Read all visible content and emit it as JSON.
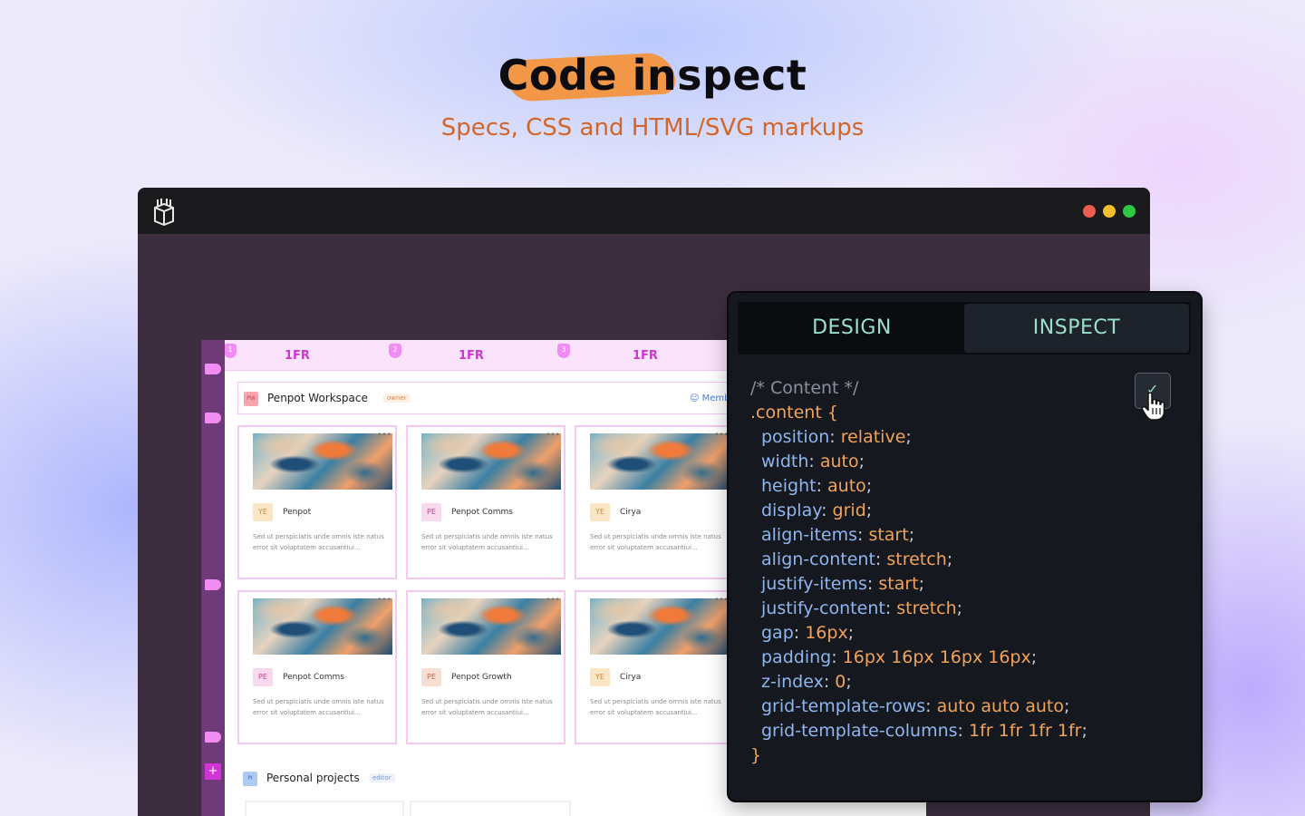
{
  "hero": {
    "title": "Code inspect",
    "subtitle": "Specs, CSS and HTML/SVG markups"
  },
  "colors": {
    "accent_orange": "#f29748",
    "subtitle_orange": "#d1662a",
    "window_bg": "#3c2e3f",
    "panel_bg": "#15181e",
    "tab_text": "#9be0c9",
    "guide_pink": "#d233d6"
  },
  "window": {
    "logo_icon": "penpot-cube-icon",
    "controls": [
      "close",
      "minimize",
      "maximize"
    ]
  },
  "board": {
    "columns": [
      "1FR",
      "1FR",
      "1FR"
    ],
    "column_pins": [
      "1",
      "2",
      "3"
    ],
    "workspace": {
      "avatar": "PW",
      "name": "Penpot Workspace",
      "role": "owner",
      "members_label": "Memb"
    },
    "cards": [
      {
        "avatar": "YE",
        "avatar_bg": "#fbe6c6",
        "avatar_fg": "#c98a2e",
        "title": "Penpot",
        "desc": "Sed ut perspiciatis unde omnis iste natus error sit voluptatem accusantiui..."
      },
      {
        "avatar": "PE",
        "avatar_bg": "#f8d9ee",
        "avatar_fg": "#b8488a",
        "title": "Penpot Comms",
        "desc": "Sed ut perspiciatis unde omnis iste natus error sit voluptatem accusantiui..."
      },
      {
        "avatar": "YE",
        "avatar_bg": "#fbe6c6",
        "avatar_fg": "#c98a2e",
        "title": "Cirya",
        "desc": "Sed ut perspiciatis unde omnis iste natus error sit voluptatem accusantiui..."
      },
      {
        "avatar": "PE",
        "avatar_bg": "#f8d9ee",
        "avatar_fg": "#b8488a",
        "title": "Penpot Comms",
        "desc": "Sed ut perspiciatis unde omnis iste natus error sit voluptatem accusantiui..."
      },
      {
        "avatar": "PE",
        "avatar_bg": "#f6dfd2",
        "avatar_fg": "#b8664a",
        "title": "Penpot Growth",
        "desc": "Sed ut perspiciatis unde omnis iste natus error sit voluptatem accusantiui..."
      },
      {
        "avatar": "YE",
        "avatar_bg": "#fbe6c6",
        "avatar_fg": "#c98a2e",
        "title": "Cirya",
        "desc": "Sed ut perspiciatis unde omnis iste natus error sit voluptatem accusantiui..."
      }
    ],
    "personal": {
      "avatar": "PI",
      "name": "Personal projects",
      "role": "editor"
    },
    "add_symbol": "+"
  },
  "panel": {
    "tabs": [
      "DESIGN",
      "INSPECT"
    ],
    "copy_icon": "check-icon",
    "code": {
      "comment": "/* Content */",
      "selector": ".content {",
      "declarations": [
        {
          "prop": "position",
          "value": "relative"
        },
        {
          "prop": "width",
          "value": "auto"
        },
        {
          "prop": "height",
          "value": "auto"
        },
        {
          "prop": "display",
          "value": "grid"
        },
        {
          "prop": "align-items",
          "value": "start"
        },
        {
          "prop": "align-content",
          "value": "stretch"
        },
        {
          "prop": "justify-items",
          "value": "start"
        },
        {
          "prop": "justify-content",
          "value": "stretch"
        },
        {
          "prop": "gap",
          "value": "16px"
        },
        {
          "prop": "padding",
          "value": "16px 16px 16px 16px"
        },
        {
          "prop": "z-index",
          "value": "0"
        },
        {
          "prop": "grid-template-rows",
          "value": "auto auto auto"
        },
        {
          "prop": "grid-template-columns",
          "value": "1fr 1fr 1fr 1fr"
        }
      ],
      "closing": "}"
    }
  }
}
